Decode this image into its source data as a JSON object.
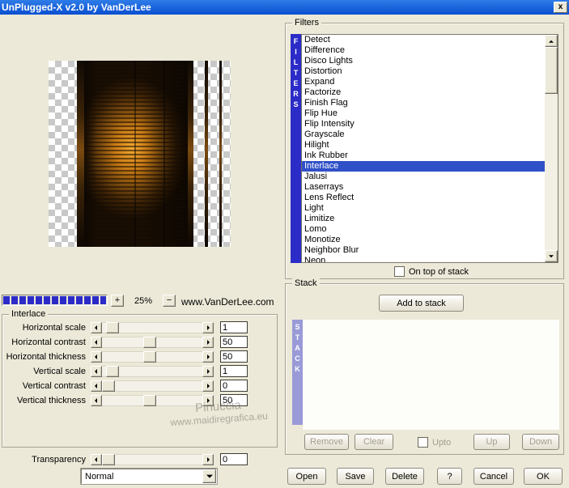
{
  "colors": {
    "dialog_bg": "#ECE9D8",
    "titlebar_a": "#2E7CE8",
    "titlebar_b": "#0A4FD0",
    "selection": "#3050C8",
    "filters_bar": "#2B2BC8",
    "stack_bar": "#9A9AD8",
    "progress_fill": "#2B2BC8"
  },
  "window": {
    "title": "UnPlugged-X v2.0 by VanDerLee",
    "close_label": "x"
  },
  "preview": {
    "zoom_in_label": "+",
    "zoom_level": "25%",
    "zoom_out_label": "−",
    "website": "www.VanDerLee.com"
  },
  "interlace_panel": {
    "group_label": "Interlace",
    "sliders": [
      {
        "label": "Horizontal scale",
        "value": "1",
        "pos": 5
      },
      {
        "label": "Horizontal contrast",
        "value": "50",
        "pos": 47
      },
      {
        "label": "Horizontal thickness",
        "value": "50",
        "pos": 47
      },
      {
        "label": "Vertical scale",
        "value": "1",
        "pos": 5
      },
      {
        "label": "Vertical contrast",
        "value": "0",
        "pos": 0
      },
      {
        "label": "Vertical thickness",
        "value": "50",
        "pos": 47
      }
    ],
    "transparency": {
      "label": "Transparency",
      "value": "0",
      "pos": 0
    },
    "blend_mode": "Normal"
  },
  "filters_panel": {
    "group_label": "Filters",
    "vertical_label": "FILTERS",
    "items": [
      "Detect",
      "Difference",
      "Disco Lights",
      "Distortion",
      "Expand",
      "Factorize",
      "Finish Flag",
      "Flip Hue",
      "Flip Intensity",
      "Grayscale",
      "Hilight",
      "Ink Rubber",
      "Interlace",
      "Jalusi",
      "Laserrays",
      "Lens Reflect",
      "Light",
      "Limitize",
      "Lomo",
      "Monotize",
      "Neighbor Blur",
      "Neon"
    ],
    "selected": "Interlace",
    "on_top_label": "On top of stack"
  },
  "stack_panel": {
    "group_label": "Stack",
    "vertical_label": "STACK",
    "add_button": "Add to stack",
    "remove_button": "Remove",
    "clear_button": "Clear",
    "upto_label": "Upto",
    "up_button": "Up",
    "down_button": "Down"
  },
  "bottom_buttons": {
    "open": "Open",
    "save": "Save",
    "delete": "Delete",
    "help": "?",
    "cancel": "Cancel",
    "ok": "OK"
  },
  "watermark": {
    "line1": "Pinuccia",
    "line2": "www.maidiregrafica.eu"
  }
}
